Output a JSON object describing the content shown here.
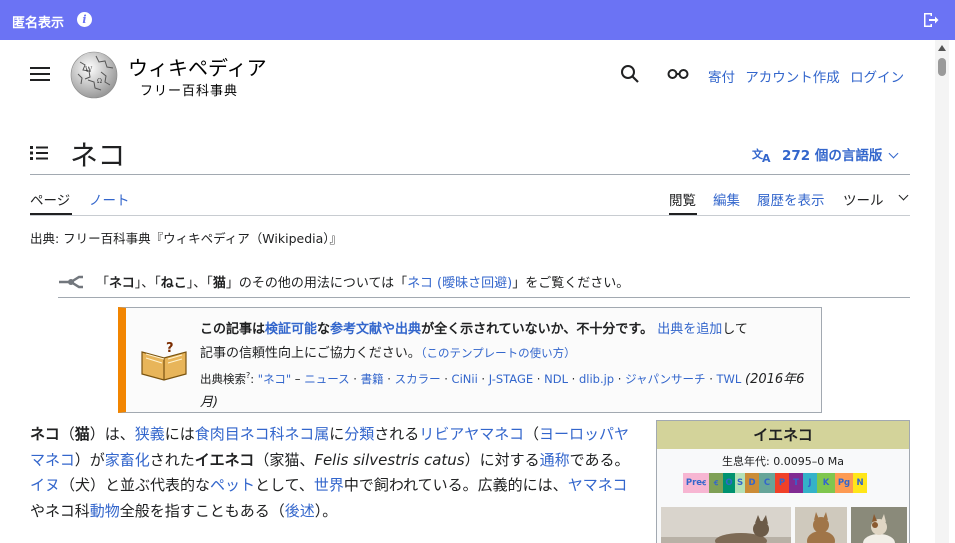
{
  "topbar": {
    "title": "匿名表示",
    "info_glyph": "i"
  },
  "header": {
    "wordmark": "ウィキペディア",
    "tagline": "フリー百科事典",
    "links": [
      "寄付",
      "アカウント作成",
      "ログイン"
    ]
  },
  "article": {
    "title": "ネコ",
    "languages": "272 個の言語版",
    "tabs_left": [
      "ページ",
      "ノート"
    ],
    "tabs_right": [
      "閲覧",
      "編集",
      "履歴を表示",
      "ツール"
    ],
    "source": "出典: フリー百科事典『ウィキペディア（Wikipedia）』",
    "hatnote": {
      "q1": "「",
      "t1": "ネコ",
      "q2": "」、「",
      "t2": "ねこ",
      "q3": "」、「",
      "t3": "猫",
      "q4": "」のその他の用法については「",
      "link": "ネコ (曖昧さ回避)",
      "q5": "」をご覧ください。"
    },
    "ambox": {
      "p1": "この記事は",
      "l1": "検証可能",
      "p2": "な",
      "l2": "参考文献や出典",
      "p3": "が全く示されていないか、不十分です。",
      "l3": "出典を追加",
      "p4": "して",
      "p5": "記事の信頼性向上にご協力ください。",
      "l4": "（このテンプレートの使い方）",
      "search_label": "出典検索",
      "search_sup": "?",
      "search_colon": ": ",
      "search_query": "\"ネコ\"",
      "search_sep": " – ",
      "search_items": [
        "ニュース",
        "書籍",
        "スカラー",
        "CiNii",
        "J-STAGE",
        "NDL",
        "dlib.jp",
        "ジャパンサーチ",
        "TWL"
      ],
      "date": "(2016年6月)"
    },
    "body": {
      "b1": "ネコ",
      "t1": "（",
      "b2": "猫",
      "t2": "）は、",
      "l1": "狭義",
      "t3": "には",
      "l2": "食肉目",
      "l3": "ネコ科",
      "l4": "ネコ属",
      "t4": "に",
      "l5": "分類",
      "t5": "される",
      "l6": "リビアヤマネコ",
      "t6": "（",
      "l7": "ヨーロッパヤマネコ",
      "t7": "）が",
      "l8": "家畜化",
      "t8": "された",
      "b3": "イエネコ",
      "t9": "（家猫、",
      "i1": "Felis silvestris catus",
      "t10": "）に対する",
      "l9": "通称",
      "t11": "である。",
      "l10": "イヌ",
      "t12": "（犬）と並ぶ代表的な",
      "l11": "ペット",
      "t13": "として、",
      "l12": "世界",
      "t14": "中で飼われている。広義的には、",
      "l13": "ヤマネコ",
      "t15": "やネコ科",
      "l14": "動物",
      "t16": "全般を指すこともある（",
      "l15": "後述",
      "t17": "）。"
    },
    "infobox": {
      "title": "イエネコ",
      "range": "生息年代: 0.0095–0 Ma",
      "periods": [
        "Preꞓ",
        "ꞓ",
        "O",
        "S",
        "D",
        "C",
        "P",
        "T",
        "J",
        "K",
        "Pg",
        "N"
      ],
      "period_colors": [
        "#f7b6d2",
        "#7fa056",
        "#009270",
        "#b3e1b6",
        "#cb8c37",
        "#67a599",
        "#f04028",
        "#812b92",
        "#34b2c9",
        "#7fc64e",
        "#fd9a52",
        "#ffe619"
      ]
    }
  },
  "colors": {
    "accent": "#6b73f4",
    "link": "#3366cc",
    "warning": "#f28500"
  }
}
